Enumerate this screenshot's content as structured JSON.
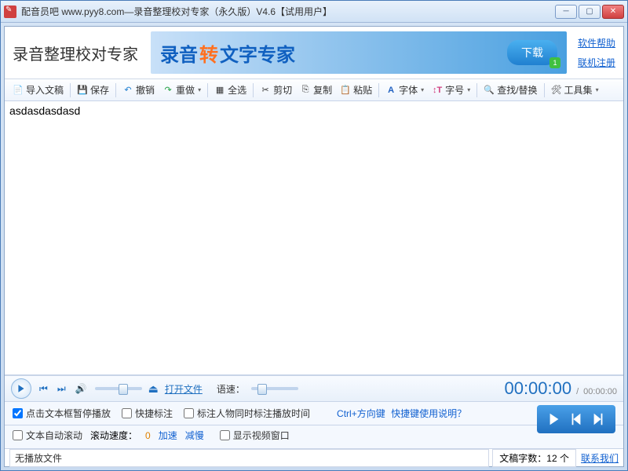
{
  "window": {
    "title": "配音员吧 www.pyy8.com—录音整理校对专家（永久版）V4.6【试用用户】"
  },
  "header": {
    "app_title": "录音整理校对专家",
    "banner_p1": "录音",
    "banner_p2": "转",
    "banner_p3": "文字专家",
    "download": "下载",
    "badge": "1",
    "link_help": "软件帮助",
    "link_register": "联机注册"
  },
  "toolbar": {
    "import": "导入文稿",
    "save": "保存",
    "undo": "撤销",
    "redo": "重做",
    "select_all": "全选",
    "cut": "剪切",
    "copy": "复制",
    "paste": "粘贴",
    "font": "字体",
    "size": "字号",
    "find": "查找/替换",
    "tools": "工具集"
  },
  "editor": {
    "content": "asdasdasdasd"
  },
  "player": {
    "open_file": "打开文件",
    "rate_label": "语速：",
    "time_current": "00:00:00",
    "time_sep": "/",
    "time_total": "00:00:00"
  },
  "options": {
    "chk_pause": "点击文本框暂停播放",
    "chk_quickmark": "快捷标注",
    "chk_marktime": "标注人物同时标注播放时间",
    "shortcut_prefix": "Ctrl+方向键",
    "shortcut_link": "快捷键使用说明？",
    "chk_autoscroll": "文本自动滚动",
    "scroll_speed_label": "滚动速度：",
    "scroll_speed_value": "0",
    "faster": "加速",
    "slower": "减慢",
    "chk_showvideo": "显示视频窗口"
  },
  "status": {
    "no_file": "无播放文件",
    "word_count_label": "文稿字数：",
    "word_count_value": "12 个",
    "contact": "联系我们"
  }
}
